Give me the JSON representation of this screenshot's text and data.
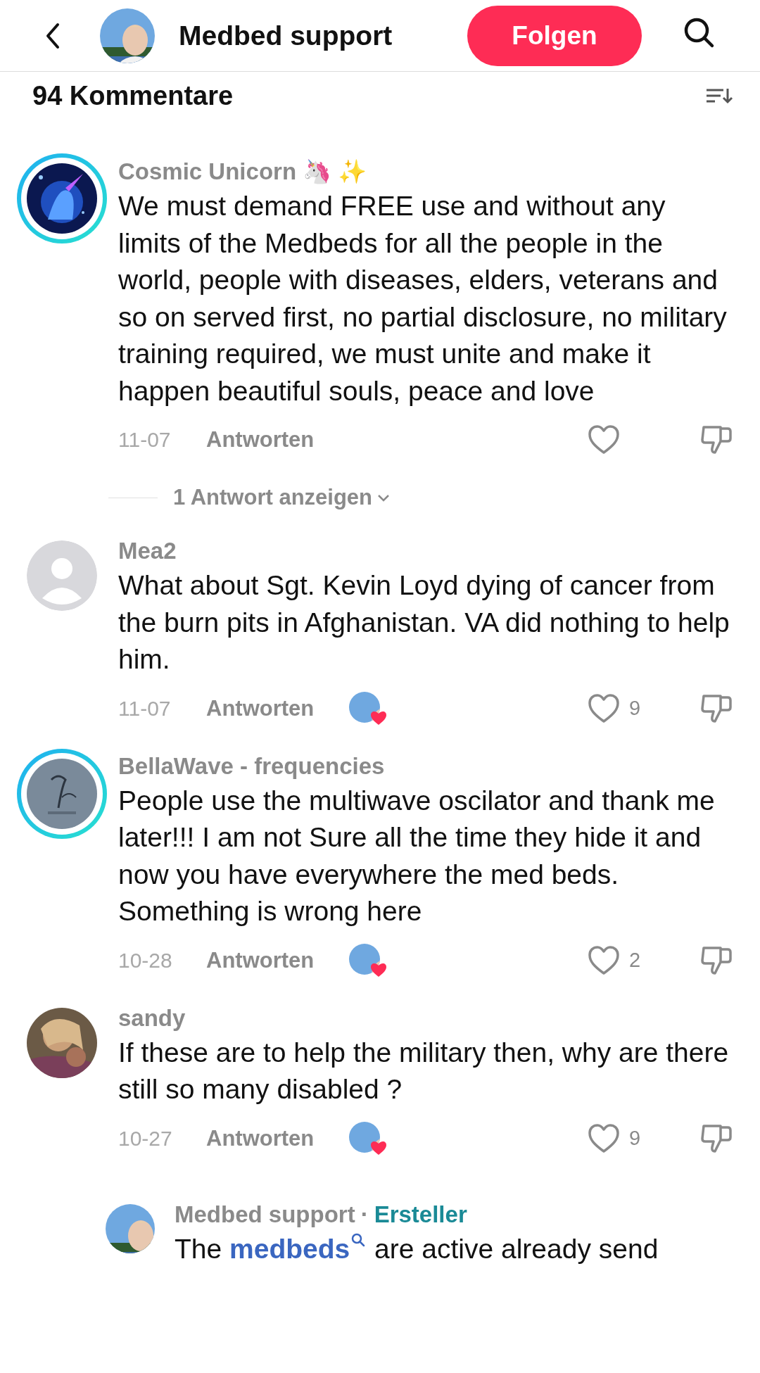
{
  "header": {
    "title": "Medbed support",
    "follow_button": "Folgen"
  },
  "comments_count": "94 Kommentare",
  "comments": [
    {
      "kind": "comment",
      "author": "Cosmic Unicorn 🦄 ✨",
      "story_ring": true,
      "body": [
        {
          "text": "We must demand FREE use and without any limits of the Medbeds for all the people in the world, people with diseases, elders, veterans and so on served first, no partial disclosure, no military training required, we must unite and make it happen beautiful souls, peace and love"
        }
      ],
      "date": "11-07",
      "reply_label": "Antworten",
      "creator_liked": false,
      "replies_link": "1 Antwort anzeigen"
    },
    {
      "kind": "comment",
      "author": "Mea2",
      "story_ring": false,
      "avatar": {
        "kind": "default"
      },
      "body": [
        {
          "text": "What about Sgt. Kevin Loyd dying of cancer from the burn pits in Afghanistan. VA did nothing to help him."
        }
      ],
      "date": "11-07",
      "reply_label": "Antworten",
      "creator_liked": true,
      "likes": "9"
    },
    {
      "kind": "comment",
      "author": "BellaWave - frequencies",
      "story_ring": true,
      "body": [
        {
          "text": "People use the multiwave oscilator and thank me later!!! I am not Sure all the time they hide it and now you have everywhere the med beds. Something is wrong here"
        }
      ],
      "date": "10-28",
      "reply_label": "Antworten",
      "creator_liked": true,
      "likes": "2"
    },
    {
      "kind": "comment",
      "author": "sandy",
      "story_ring": false,
      "body": [
        {
          "text": "If these are to help the military then, why are there still so many disabled ?"
        }
      ],
      "date": "10-27",
      "reply_label": "Antworten",
      "creator_liked": true,
      "likes": "9"
    },
    {
      "kind": "reply",
      "author": "Medbed support",
      "separator": "·",
      "badge": "Ersteller",
      "story_ring": false,
      "body": [
        {
          "text": "The "
        },
        {
          "text": "medbeds",
          "kind": "link"
        },
        {
          "text": " are active already send"
        }
      ]
    }
  ]
}
